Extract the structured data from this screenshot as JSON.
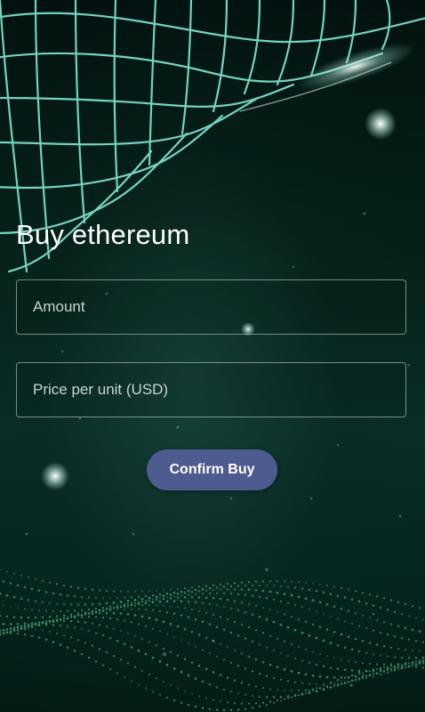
{
  "screen": {
    "title": "Buy ethereum"
  },
  "form": {
    "amount_placeholder": "Amount",
    "amount_value": "",
    "price_placeholder": "Price per unit (USD)",
    "price_value": "",
    "confirm_label": "Confirm Buy"
  },
  "colors": {
    "background": "#052019",
    "grid_lines": "#7ee3d0",
    "particle_dots": "#5fbf86",
    "button": "#4d5b8e",
    "text": "#ffffff"
  }
}
